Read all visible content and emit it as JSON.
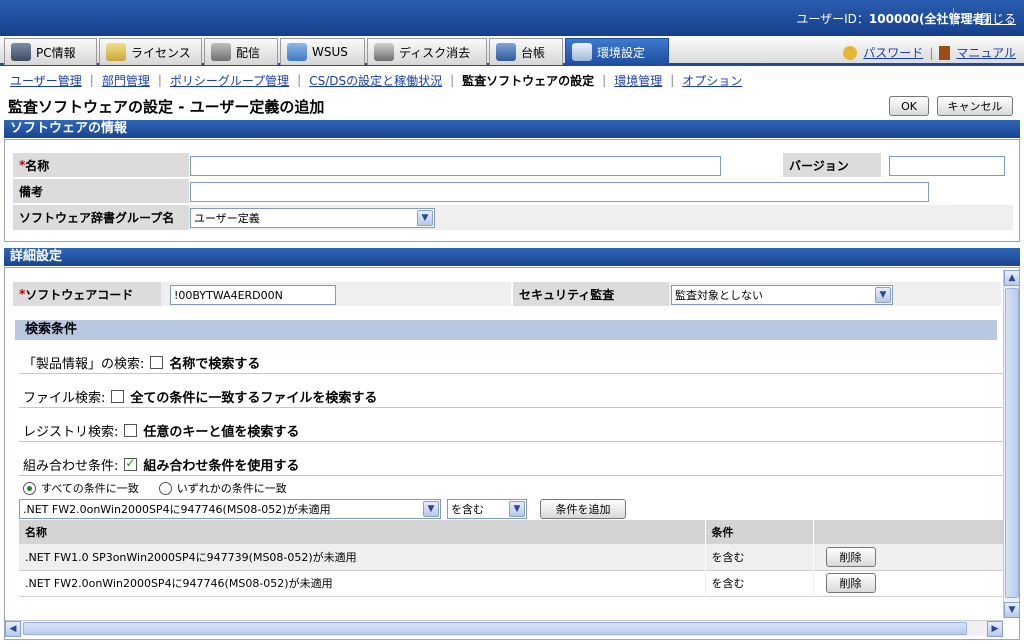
{
  "header": {
    "user_text": "ユーザーID：",
    "user_id": "100000(全社管理者)",
    "logout": "閉じる"
  },
  "tabs": [
    {
      "label": "PC情報",
      "icon": "pc-icon"
    },
    {
      "label": "ライセンス",
      "icon": "license-icon"
    },
    {
      "label": "配信",
      "icon": "distribution-icon"
    },
    {
      "label": "WSUS",
      "icon": "wsus-icon"
    },
    {
      "label": "ディスク消去",
      "icon": "disk-erase-icon"
    },
    {
      "label": "台帳",
      "icon": "ledger-icon"
    },
    {
      "label": "環境設定",
      "icon": "settings-icon"
    }
  ],
  "links": {
    "password": "パスワード",
    "manual": "マニュアル"
  },
  "subnav": [
    "ユーザー管理",
    "部門管理",
    "ポリシーグループ管理",
    "CS/DSの設定と稼働状況",
    "監査ソフトウェアの設定",
    "環境管理",
    "オプション"
  ],
  "page_title": "監査ソフトウェアの設定 - ユーザー定義の追加",
  "buttons": {
    "ok": "OK",
    "cancel": "キャンセル",
    "add_condition": "条件を追加",
    "delete": "削除"
  },
  "software_info": {
    "header": "ソフトウェアの情報",
    "name_label": "名称",
    "name_value": "",
    "version_label": "バージョン",
    "version_value": "",
    "note_label": "備考",
    "note_value": "",
    "group_label": "ソフトウェア辞書グループ名",
    "group_value": "ユーザー定義"
  },
  "details": {
    "header": "詳細設定",
    "code_label": "ソフトウェアコード",
    "code_value": "!00BYTWA4ERD00N",
    "security_label": "セキュリティ監査",
    "security_value": "監査対象としない",
    "search_header": "検索条件",
    "product_search_label": "「製品情報」の検索:",
    "product_search_option": "名称で検索する",
    "file_search_label": "ファイル検索:",
    "file_search_option": "全ての条件に一致するファイルを検索する",
    "registry_search_label": "レジストリ検索:",
    "registry_search_option": "任意のキーと値を検索する",
    "combo_label": "組み合わせ条件:",
    "combo_option": "組み合わせ条件を使用する",
    "radio_all": "すべての条件に一致",
    "radio_any": "いずれかの条件に一致",
    "condition_select": ".NET FW2.0onWin2000SP4に947746(MS08-052)が未適用",
    "operator_select": "を含む",
    "table_headers": [
      "名称",
      "条件",
      ""
    ],
    "rows": [
      {
        "name": ".NET FW1.0 SP3onWin2000SP4に947739(MS08-052)が未適用",
        "cond": "を含む"
      },
      {
        "name": ".NET FW2.0onWin2000SP4に947746(MS08-052)が未適用",
        "cond": "を含む"
      }
    ]
  }
}
